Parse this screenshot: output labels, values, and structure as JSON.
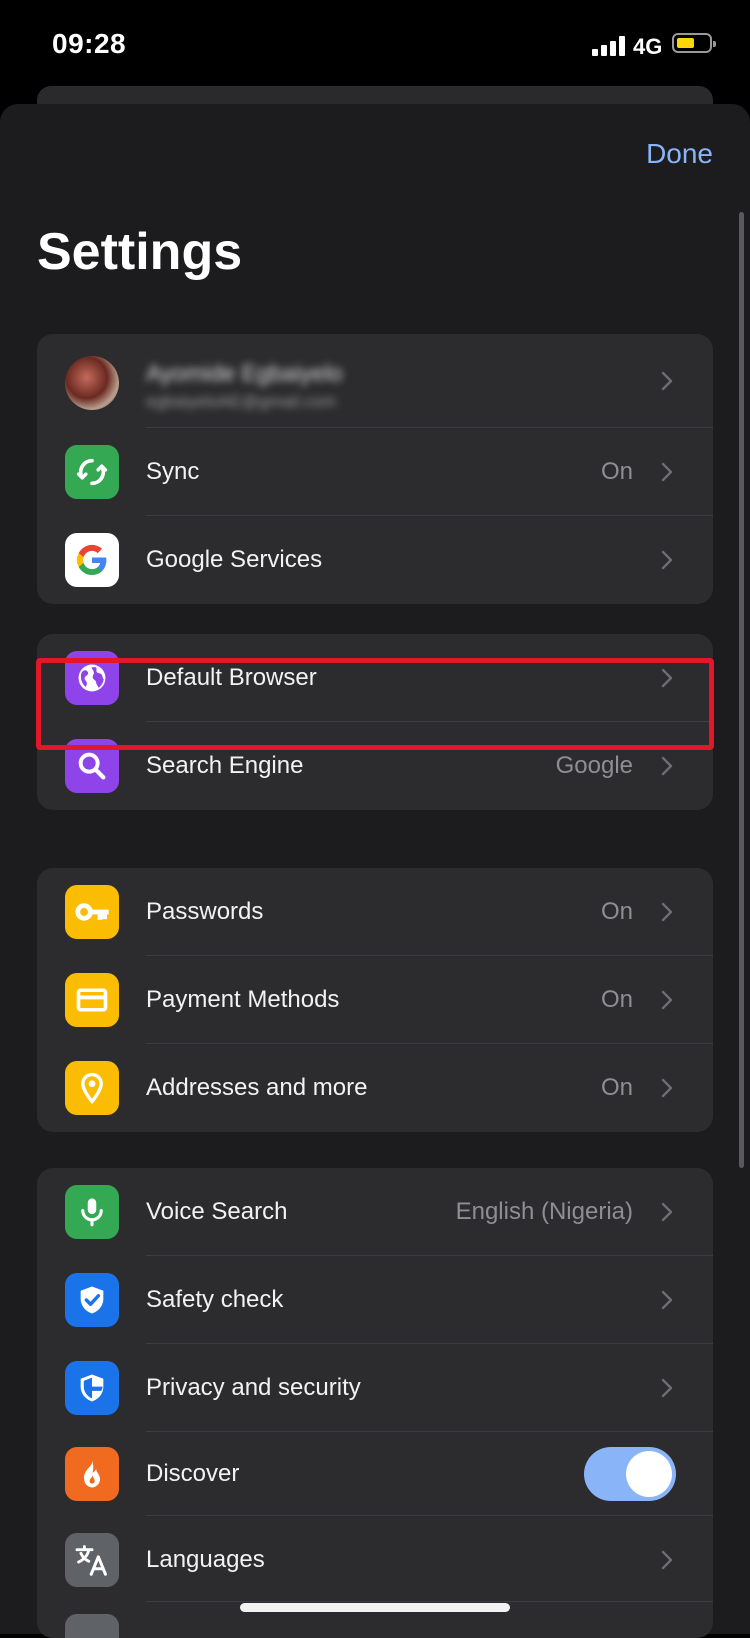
{
  "status": {
    "time": "09:28",
    "network": "4G"
  },
  "header": {
    "done_label": "Done",
    "title": "Settings"
  },
  "account": {
    "name": "Ayomide Egbaiyelo",
    "email": "egbaiyeloAE@gmail.com"
  },
  "groups": {
    "account_group": [
      {
        "label": "Sync",
        "value": "On",
        "icon": "sync-icon",
        "color": "#34a853"
      },
      {
        "label": "Google Services",
        "value": "",
        "icon": "google-logo-icon",
        "color": "#ffffff"
      }
    ],
    "browser_group": [
      {
        "label": "Default Browser",
        "value": "",
        "icon": "globe-icon",
        "color": "#8e44e8"
      },
      {
        "label": "Search Engine",
        "value": "Google",
        "icon": "search-icon",
        "color": "#8e44e8"
      }
    ],
    "autofill_group": [
      {
        "label": "Passwords",
        "value": "On",
        "icon": "key-icon",
        "color": "#fbbc04"
      },
      {
        "label": "Payment Methods",
        "value": "On",
        "icon": "credit-card-icon",
        "color": "#fbbc04"
      },
      {
        "label": "Addresses and more",
        "value": "On",
        "icon": "location-pin-icon",
        "color": "#fbbc04"
      }
    ],
    "advanced_group": [
      {
        "label": "Voice Search",
        "value": "English (Nigeria)",
        "icon": "microphone-icon",
        "color": "#34a853"
      },
      {
        "label": "Safety check",
        "value": "",
        "icon": "shield-check-icon",
        "color": "#1a73e8"
      },
      {
        "label": "Privacy and security",
        "value": "",
        "icon": "shield-icon",
        "color": "#1a73e8"
      },
      {
        "label": "Discover",
        "value": "",
        "icon": "flame-icon",
        "color": "#f06b1f",
        "toggle": true
      },
      {
        "label": "Languages",
        "value": "",
        "icon": "translate-icon",
        "color": "#5f6368"
      }
    ]
  },
  "colors": {
    "accent": "#8ab4f8",
    "highlight": "#e3162a",
    "sheet_bg": "#1c1c1e",
    "group_bg": "#2c2c2e"
  }
}
